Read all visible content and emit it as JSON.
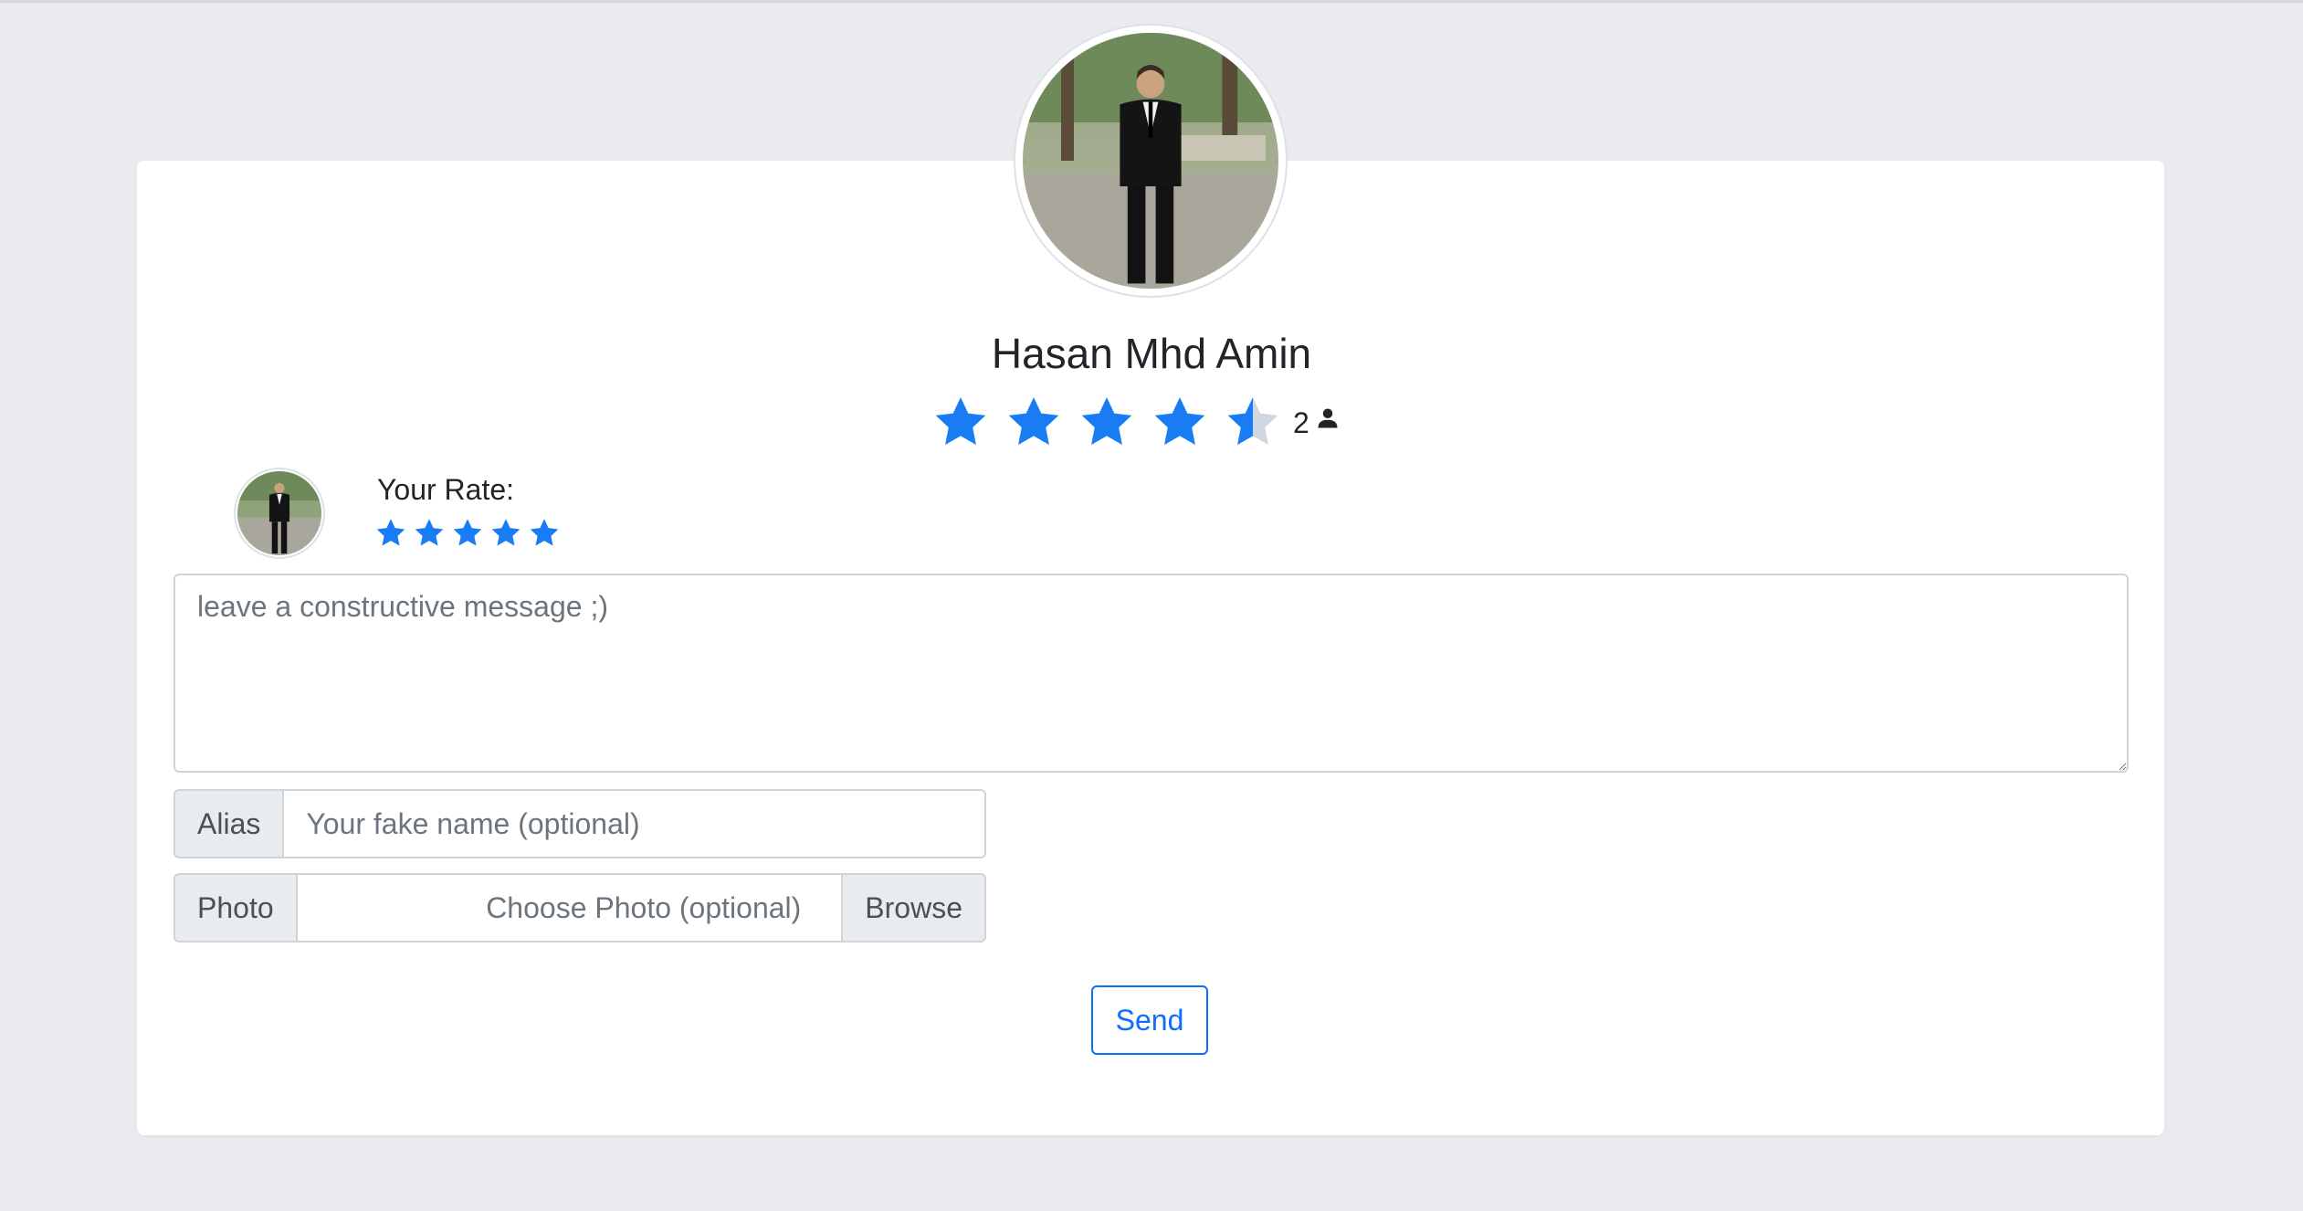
{
  "profile": {
    "name": "Hasan Mhd Amin",
    "rating": 4.5,
    "max_rating": 5,
    "rating_count": "2",
    "avatar_icon": "profile-photo",
    "count_icon": "person-icon"
  },
  "your_rate": {
    "label": "Your Rate:",
    "stars": 5
  },
  "form": {
    "message_placeholder": "leave a constructive message ;)",
    "alias_label": "Alias",
    "alias_placeholder": "Your fake name (optional)",
    "photo_label": "Photo",
    "photo_placeholder": "Choose Photo (optional)",
    "browse_label": "Browse",
    "send_label": "Send"
  },
  "colors": {
    "accent": "#1a7cf5",
    "star_empty": "#cfd7e3",
    "background": "#e9ebef",
    "card": "#ffffff"
  }
}
